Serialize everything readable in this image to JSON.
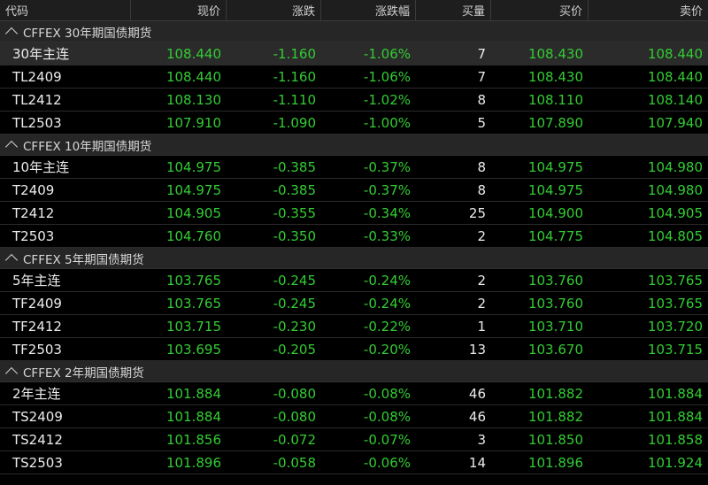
{
  "columns": [
    "代码",
    "现价",
    "涨跌",
    "涨跌幅",
    "买量",
    "买价",
    "卖价"
  ],
  "groups": [
    {
      "title": "CFFEX 30年期国债期货",
      "rows": [
        {
          "code": "30年主连",
          "price": "108.440",
          "change": "-1.160",
          "pct": "-1.06%",
          "vol": "7",
          "bid": "108.430",
          "ask": "108.440"
        },
        {
          "code": "TL2409",
          "price": "108.440",
          "change": "-1.160",
          "pct": "-1.06%",
          "vol": "7",
          "bid": "108.430",
          "ask": "108.440"
        },
        {
          "code": "TL2412",
          "price": "108.130",
          "change": "-1.110",
          "pct": "-1.02%",
          "vol": "8",
          "bid": "108.110",
          "ask": "108.140"
        },
        {
          "code": "TL2503",
          "price": "107.910",
          "change": "-1.090",
          "pct": "-1.00%",
          "vol": "5",
          "bid": "107.890",
          "ask": "107.940"
        }
      ]
    },
    {
      "title": "CFFEX 10年期国债期货",
      "rows": [
        {
          "code": "10年主连",
          "price": "104.975",
          "change": "-0.385",
          "pct": "-0.37%",
          "vol": "8",
          "bid": "104.975",
          "ask": "104.980"
        },
        {
          "code": "T2409",
          "price": "104.975",
          "change": "-0.385",
          "pct": "-0.37%",
          "vol": "8",
          "bid": "104.975",
          "ask": "104.980"
        },
        {
          "code": "T2412",
          "price": "104.905",
          "change": "-0.355",
          "pct": "-0.34%",
          "vol": "25",
          "bid": "104.900",
          "ask": "104.905"
        },
        {
          "code": "T2503",
          "price": "104.760",
          "change": "-0.350",
          "pct": "-0.33%",
          "vol": "2",
          "bid": "104.775",
          "ask": "104.805"
        }
      ]
    },
    {
      "title": "CFFEX 5年期国债期货",
      "rows": [
        {
          "code": "5年主连",
          "price": "103.765",
          "change": "-0.245",
          "pct": "-0.24%",
          "vol": "2",
          "bid": "103.760",
          "ask": "103.765"
        },
        {
          "code": "TF2409",
          "price": "103.765",
          "change": "-0.245",
          "pct": "-0.24%",
          "vol": "2",
          "bid": "103.760",
          "ask": "103.765"
        },
        {
          "code": "TF2412",
          "price": "103.715",
          "change": "-0.230",
          "pct": "-0.22%",
          "vol": "1",
          "bid": "103.710",
          "ask": "103.720"
        },
        {
          "code": "TF2503",
          "price": "103.695",
          "change": "-0.205",
          "pct": "-0.20%",
          "vol": "13",
          "bid": "103.670",
          "ask": "103.715"
        }
      ]
    },
    {
      "title": "CFFEX 2年期国债期货",
      "rows": [
        {
          "code": "2年主连",
          "price": "101.884",
          "change": "-0.080",
          "pct": "-0.08%",
          "vol": "46",
          "bid": "101.882",
          "ask": "101.884"
        },
        {
          "code": "TS2409",
          "price": "101.884",
          "change": "-0.080",
          "pct": "-0.08%",
          "vol": "46",
          "bid": "101.882",
          "ask": "101.884"
        },
        {
          "code": "TS2412",
          "price": "101.856",
          "change": "-0.072",
          "pct": "-0.07%",
          "vol": "3",
          "bid": "101.850",
          "ask": "101.858"
        },
        {
          "code": "TS2503",
          "price": "101.896",
          "change": "-0.058",
          "pct": "-0.06%",
          "vol": "14",
          "bid": "101.896",
          "ask": "101.924"
        }
      ]
    }
  ],
  "colors": {
    "down": "#33cc33",
    "neutral": "#ececec",
    "background": "#000000",
    "group_bg": "#262626",
    "header_bg": "#1e1e1e"
  },
  "icons": {
    "group_toggle": "chevron-up-icon"
  }
}
